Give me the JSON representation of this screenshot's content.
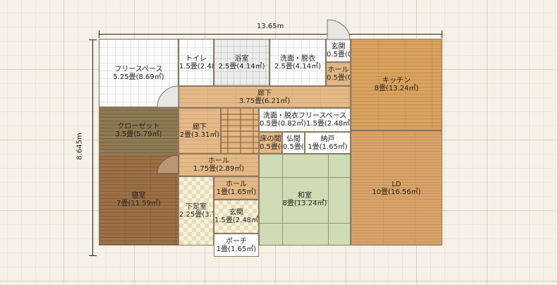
{
  "dimensions": {
    "width": "13.65m",
    "height": "8.645m"
  },
  "rooms": {
    "free_space": {
      "name": "フリースペース",
      "size": "5.25畳(8.69㎡)"
    },
    "toilet": {
      "name": "トイレ",
      "size": "1.5畳(2.48㎡)"
    },
    "bath": {
      "name": "浴室",
      "size": "2.5畳(4.14㎡)"
    },
    "washroom1": {
      "name": "洗面・脱衣",
      "size": "2.5畳(4.14㎡)"
    },
    "entrance_small": {
      "name": "玄関",
      "size": "0.5畳(0.82㎡)"
    },
    "hall_small": {
      "name": "ホール",
      "size": "0.5畳(0.82㎡)"
    },
    "kitchen": {
      "name": "キッチン",
      "size": "8畳(13.24㎡)"
    },
    "corridor_main": {
      "name": "廊下",
      "size": "3.75畳(6.21㎡)"
    },
    "closet": {
      "name": "クローゼット",
      "size": "3.5畳(5.79㎡)"
    },
    "corridor_small": {
      "name": "廊下",
      "size": "2畳(3.31㎡)"
    },
    "washroom2": {
      "name": "洗面・脱衣",
      "size": "0.5畳(0.82㎡)"
    },
    "free_space2": {
      "name": "フリースペース",
      "size": "1.5畳(2.48㎡)"
    },
    "tokonoma": {
      "name": "床の間",
      "size": "0.5畳(0.82㎡)"
    },
    "butsuma": {
      "name": "仏間",
      "size": "0.5畳(0.82㎡)"
    },
    "storage": {
      "name": "納戸",
      "size": "1畳(1.65㎡)"
    },
    "hall_mid": {
      "name": "ホール",
      "size": "1.75畳(2.89㎡)"
    },
    "bedroom": {
      "name": "寝室",
      "size": "7畳(11.59㎡)"
    },
    "shoe_room": {
      "name": "下足室",
      "size": "2.25畳(3.72㎡)"
    },
    "hall_lower": {
      "name": "ホール",
      "size": "1畳(1.65㎡)"
    },
    "entrance_main": {
      "name": "玄関",
      "size": "1.5畳(2.48㎡)"
    },
    "japanese_room": {
      "name": "和室",
      "size": "8畳(13.24㎡)"
    },
    "ld": {
      "name": "LD",
      "size": "10畳(16.56㎡)"
    },
    "porch": {
      "name": "ポーチ",
      "size": "1畳(1.65㎡)"
    }
  }
}
